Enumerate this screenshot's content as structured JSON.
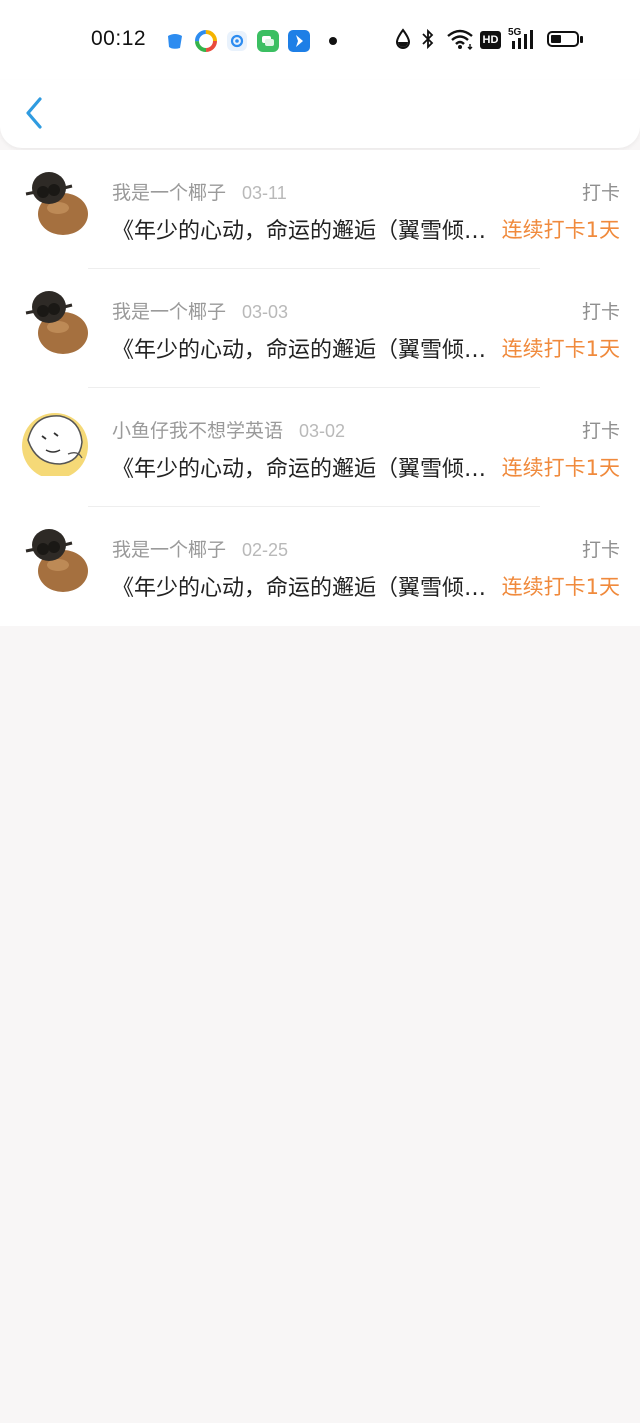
{
  "status_bar": {
    "time": "00:12",
    "app_icons": [
      "app-blue-icon",
      "app-colorful-icon",
      "app-mail-icon",
      "app-messages-icon",
      "app-arrow-icon"
    ],
    "system_icons": [
      "drop-icon",
      "bluetooth-icon",
      "wifi-icon",
      "hd-icon",
      "signal-5g-icon",
      "battery-icon"
    ],
    "hd_label": "HD",
    "network_label": "5G"
  },
  "header": {
    "back_icon": "chevron-left-icon",
    "accent": "#2f9be0"
  },
  "colors": {
    "streak": "#f08a3c",
    "name": "#9a9a9a",
    "date": "#b9b9b9"
  },
  "list": [
    {
      "avatar": "coconut-avatar",
      "name": "我是一个椰子",
      "date": "03-11",
      "type": "打卡",
      "title": "《年少的心动，命运的邂逅（翼雪倾城）》",
      "streak": "连续打卡1天"
    },
    {
      "avatar": "coconut-avatar",
      "name": "我是一个椰子",
      "date": "03-03",
      "type": "打卡",
      "title": "《年少的心动，命运的邂逅（翼雪倾城）》",
      "streak": "连续打卡1天"
    },
    {
      "avatar": "cartoon-animal-avatar",
      "name": "小鱼仔我不想学英语",
      "date": "03-02",
      "type": "打卡",
      "title": "《年少的心动，命运的邂逅（翼雪倾城）》",
      "streak": "连续打卡1天"
    },
    {
      "avatar": "coconut-avatar",
      "name": "我是一个椰子",
      "date": "02-25",
      "type": "打卡",
      "title": "《年少的心动，命运的邂逅（翼雪倾城）》",
      "streak": "连续打卡1天"
    }
  ]
}
